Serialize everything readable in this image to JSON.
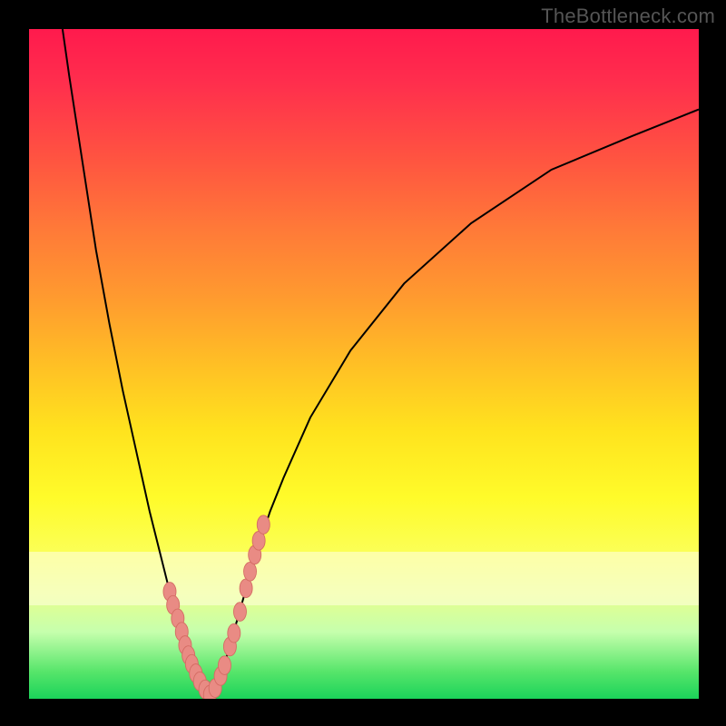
{
  "watermark": "TheBottleneck.com",
  "colors": {
    "curve": "#000000",
    "marker_fill": "#e98b84",
    "marker_stroke": "#d46b63",
    "gradient_top": "#ff1a4d",
    "gradient_bottom": "#1bd35a"
  },
  "chart_data": {
    "type": "line",
    "title": "",
    "xlabel": "",
    "ylabel": "",
    "xlim": [
      0,
      100
    ],
    "ylim": [
      0,
      100
    ],
    "grid": false,
    "legend": false,
    "annotations": [],
    "series": [
      {
        "name": "bottleneck-curve-left",
        "mode": "line",
        "x": [
          5,
          6,
          8,
          10,
          12,
          14,
          16,
          18,
          20,
          22,
          23,
          24,
          25,
          26,
          27
        ],
        "y": [
          100,
          93,
          80,
          67,
          56,
          46,
          37,
          28,
          20,
          12,
          8,
          5,
          3,
          1.5,
          0.5
        ]
      },
      {
        "name": "bottleneck-curve-right",
        "mode": "line",
        "x": [
          27,
          28,
          29,
          30,
          32,
          34,
          36,
          38,
          42,
          48,
          56,
          66,
          78,
          90,
          100
        ],
        "y": [
          0.5,
          2,
          4.5,
          8,
          15,
          22,
          28,
          33,
          42,
          52,
          62,
          71,
          79,
          84,
          88
        ]
      },
      {
        "name": "highlighted-points",
        "mode": "markers",
        "x": [
          21.0,
          21.5,
          22.2,
          22.8,
          23.3,
          23.8,
          24.3,
          24.9,
          25.5,
          26.3,
          27.0,
          27.8,
          28.6,
          29.2,
          30.0,
          30.6,
          31.5,
          32.4,
          33.0,
          33.7,
          34.3,
          35.0
        ],
        "y": [
          16.0,
          14.0,
          12.0,
          10.0,
          8.0,
          6.5,
          5.2,
          3.8,
          2.6,
          1.4,
          0.6,
          1.6,
          3.4,
          5.0,
          7.8,
          9.8,
          13.0,
          16.5,
          19.0,
          21.5,
          23.6,
          26.0
        ]
      }
    ]
  }
}
